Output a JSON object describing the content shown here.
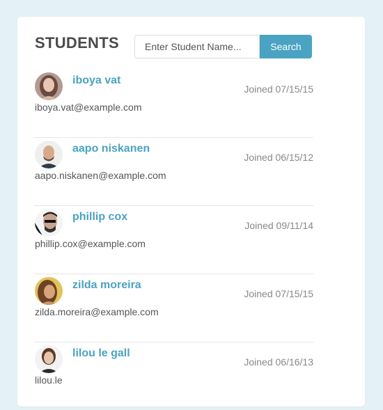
{
  "header": {
    "title": "STUDENTS",
    "search_placeholder": "Enter Student Name...",
    "search_button": "Search"
  },
  "colors": {
    "accent": "#4aa3c2",
    "background": "#e4f1f6"
  },
  "students": [
    {
      "name": "iboya vat",
      "email": "iboya.vat@example.com",
      "joined": "Joined 07/15/15"
    },
    {
      "name": "aapo niskanen",
      "email": "aapo.niskanen@example.com",
      "joined": "Joined 06/15/12"
    },
    {
      "name": "phillip cox",
      "email": "phillip.cox@example.com",
      "joined": "Joined 09/11/14"
    },
    {
      "name": "zilda moreira",
      "email": "zilda.moreira@example.com",
      "joined": "Joined 07/15/15"
    },
    {
      "name": "lilou le gall",
      "email": "lilou.le",
      "joined": "Joined 06/16/13"
    }
  ]
}
